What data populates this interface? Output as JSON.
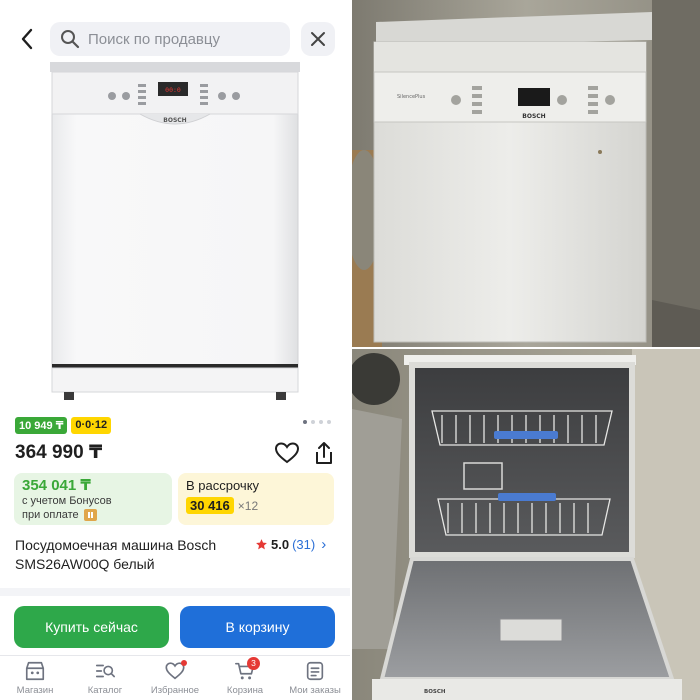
{
  "search": {
    "placeholder": "Поиск по продавцу"
  },
  "badges": {
    "installment_price": "10 949 ₸",
    "installment_plan": "0·0·12"
  },
  "price": "364 990 ₸",
  "bonus": {
    "price": "354 041 ₸",
    "note_line1": "с учетом Бонусов",
    "note_line2": "при оплате"
  },
  "credit": {
    "title": "В рассрочку",
    "amount": "30 416",
    "months": "×12"
  },
  "product": {
    "title": "Посудомоечная машина Bosch SMS26AW00Q белый",
    "brand_mark": "BOSCH"
  },
  "rating": {
    "score": "5.0",
    "count": "(31)"
  },
  "carousel": {
    "total": 4,
    "active": 0
  },
  "actions": {
    "buy_now": "Купить сейчас",
    "add_to_cart": "В корзину"
  },
  "nav": {
    "items": [
      {
        "label": "Магазин",
        "icon": "store-icon"
      },
      {
        "label": "Каталог",
        "icon": "catalog-search-icon"
      },
      {
        "label": "Избранное",
        "icon": "heart-icon"
      },
      {
        "label": "Корзина",
        "icon": "cart-icon",
        "badge": "3"
      },
      {
        "label": "Мои заказы",
        "icon": "orders-icon"
      }
    ]
  },
  "photos": {
    "top_brand": "BOSCH",
    "top_series": "SilencePlus",
    "bottom_brand": "BOSCH"
  },
  "colors": {
    "green": "#2ea84a",
    "blue": "#1f6fd9",
    "yellow": "#ffd600",
    "red": "#e53935",
    "link": "#2b6fd6"
  }
}
